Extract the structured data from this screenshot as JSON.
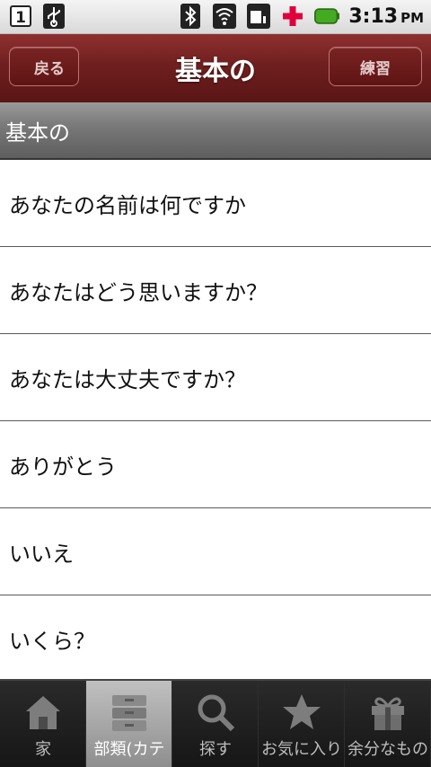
{
  "status_bar": {
    "sim_slot": "1",
    "time": "3:13",
    "ampm": "PM"
  },
  "title_bar": {
    "back_label": "戻る",
    "title": "基本の",
    "practice_label": "練習"
  },
  "section": {
    "header": "基本の"
  },
  "list": {
    "items": [
      {
        "label": "あなたの名前は何ですか"
      },
      {
        "label": "あなたはどう思いますか？"
      },
      {
        "label": "あなたは大丈夫ですか？"
      },
      {
        "label": "ありがとう"
      },
      {
        "label": "いいえ"
      },
      {
        "label": "いくら？"
      }
    ]
  },
  "tabs": [
    {
      "label": "家",
      "icon": "home-icon",
      "active": false
    },
    {
      "label": "部類(カテ",
      "icon": "categories-icon",
      "active": true
    },
    {
      "label": "探す",
      "icon": "search-icon",
      "active": false
    },
    {
      "label": "お気に入り",
      "icon": "star-icon",
      "active": false
    },
    {
      "label": "余分なもの",
      "icon": "gift-icon",
      "active": false
    }
  ],
  "colors": {
    "title_bar": "#6f1f1f",
    "battery": "#44aa22",
    "add_icon": "#e0003c"
  }
}
